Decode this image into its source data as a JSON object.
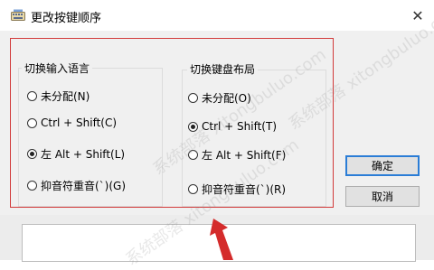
{
  "window": {
    "title": "更改按键顺序",
    "close_glyph": "✕"
  },
  "input_language_group": {
    "title": "切换输入语言",
    "options": [
      {
        "label": "未分配(N)",
        "checked": false
      },
      {
        "label": "Ctrl + Shift(C)",
        "checked": false
      },
      {
        "label": "左 Alt + Shift(L)",
        "checked": true
      },
      {
        "label": "抑音符重音(`)(G)",
        "checked": false
      }
    ]
  },
  "keyboard_layout_group": {
    "title": "切换键盘布局",
    "options": [
      {
        "label": "未分配(O)",
        "checked": false
      },
      {
        "label": "Ctrl + Shift(T)",
        "checked": true
      },
      {
        "label": "左 Alt + Shift(F)",
        "checked": false
      },
      {
        "label": "抑音符重音(`)(R)",
        "checked": false
      }
    ]
  },
  "buttons": {
    "ok": "确定",
    "cancel": "取消"
  },
  "annotation": {
    "highlight_color": "#d23a3a",
    "arrow_color": "#d42b2b"
  },
  "watermark": {
    "text": "系统部落 xitongbuluo.com"
  }
}
